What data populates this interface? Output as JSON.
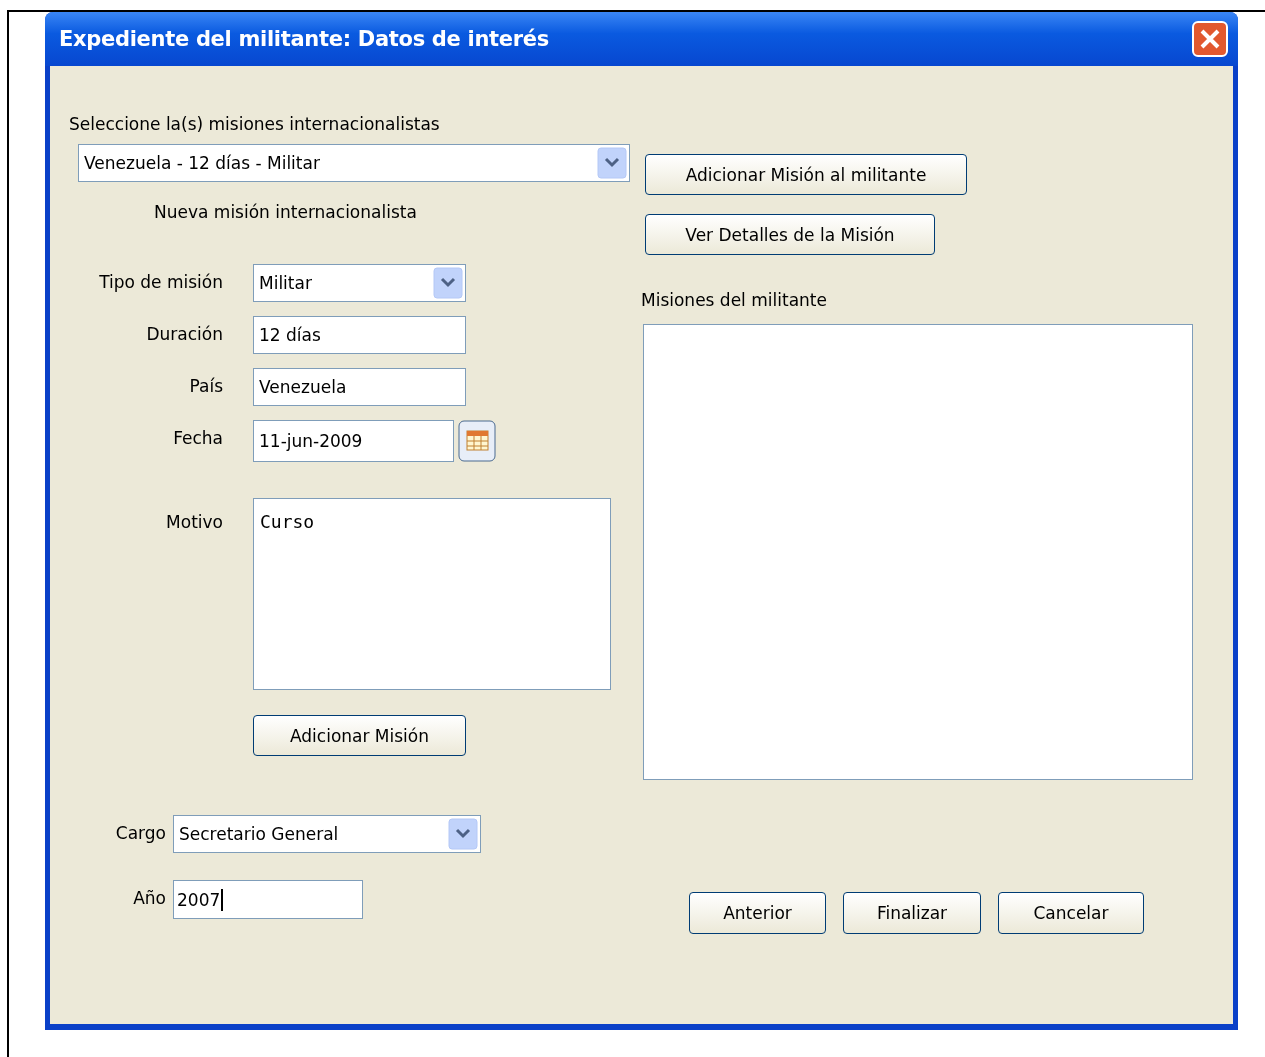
{
  "window": {
    "title": "Expediente del militante: Datos de interés"
  },
  "missions_select": {
    "label": "Seleccione la(s) misiones internacionalistas",
    "value": "Venezuela - 12 días - Militar"
  },
  "new_mission": {
    "heading": "Nueva misión internacionalista",
    "fields": [
      {
        "kind": "select",
        "label": "Tipo de misión",
        "value": "Militar"
      },
      {
        "kind": "text",
        "label": "Duración",
        "value": "12 días"
      },
      {
        "kind": "text",
        "label": "País",
        "value": "Venezuela"
      },
      {
        "kind": "date",
        "label": "Fecha",
        "value": "11-jun-2009"
      },
      {
        "kind": "textarea",
        "label": "Motivo",
        "value": "Curso"
      }
    ],
    "add_button": "Adicionar Misión"
  },
  "mission_buttons": [
    "Adicionar Misión al militante",
    "Ver Detalles de la Misión"
  ],
  "militant_missions": {
    "label": "Misiones del militante"
  },
  "cargo": {
    "label": "Cargo",
    "value": "Secretario General"
  },
  "year": {
    "label": "Año",
    "value": "2007",
    "focused": true
  },
  "footer_buttons": [
    "Anterior",
    "Finalizar",
    "Cancelar"
  ]
}
